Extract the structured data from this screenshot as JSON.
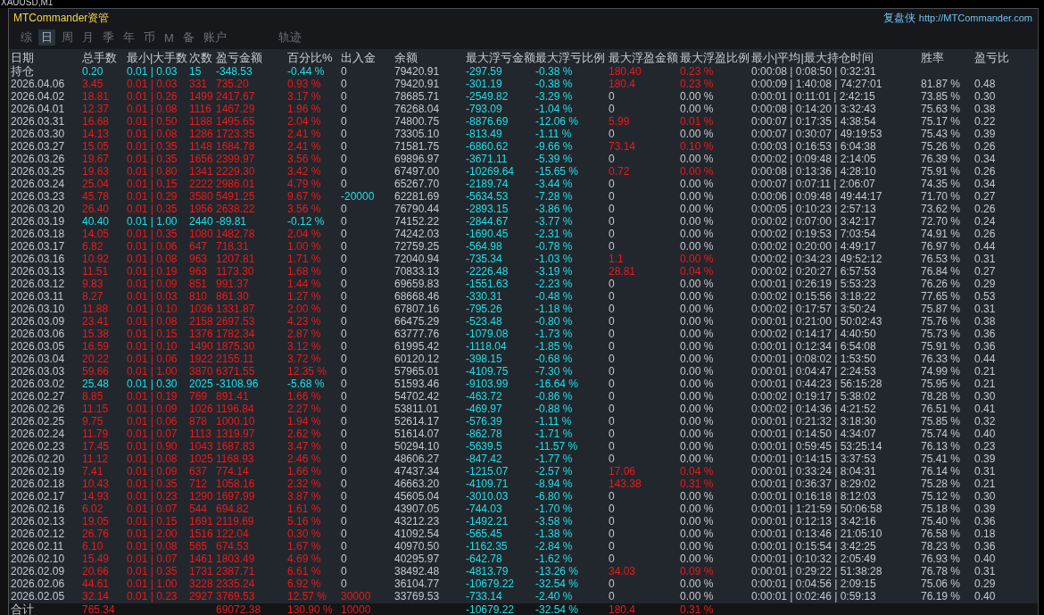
{
  "chart_window": {
    "symbol": "XAUUSD,M1"
  },
  "panel": {
    "title": "MTCommander资管",
    "brand": "复盘侠",
    "link": "http://MTCommander.com"
  },
  "tabs": [
    {
      "label": "综",
      "selected": false
    },
    {
      "label": "日",
      "selected": true
    },
    {
      "label": "周",
      "selected": false
    },
    {
      "label": "月",
      "selected": false
    },
    {
      "label": "季",
      "selected": false
    },
    {
      "label": "年",
      "selected": false
    },
    {
      "label": "币",
      "selected": false
    },
    {
      "label": "M",
      "selected": false
    },
    {
      "label": "备",
      "selected": false
    },
    {
      "label": "账户",
      "selected": false
    },
    {
      "label": "轨迹",
      "selected": false
    }
  ],
  "table": {
    "columns": [
      "日期",
      "总手数",
      "最小|大手数",
      "次数",
      "盈亏金额",
      "百分比%",
      "出入金",
      "余额",
      "最大浮亏金额",
      "最大浮亏比例",
      "最大浮盈金额",
      "最大浮盈比例",
      "最小|平均|最大持仓时间",
      "胜率",
      "盈亏比"
    ],
    "rows": [
      {
        "kind": "holding",
        "date": "持仓",
        "lots": "0.20",
        "lot_range": "0.01 | 0.03",
        "trades": "15",
        "pnl": "-348.53",
        "pnl_pct": "-0.44 %",
        "flow": "0",
        "balance": "79420.91",
        "max_float_loss": "-297.59",
        "max_float_loss_pct": "-0.38 %",
        "max_float_profit": "180.40",
        "max_float_profit_pct": "0.23 %",
        "hold_times": "0:00:08 | 0:08:50 | 0:32:31",
        "profitable": false,
        "float_profit_hit": true,
        "deposit": false,
        "withdrawal": false
      },
      {
        "kind": "day",
        "date": "2026.04.06",
        "lots": "3.45",
        "lot_range": "0.01 | 0.03",
        "trades": "331",
        "pnl": "735.20",
        "pnl_pct": "0.93 %",
        "flow": "0",
        "balance": "79420.91",
        "max_float_loss": "-301.19",
        "max_float_loss_pct": "-0.38 %",
        "max_float_profit": "180.4",
        "max_float_profit_pct": "0.23 %",
        "hold_times": "0:00:09 | 1:40:08 | 74:27:01",
        "win_rate": "81.87 %",
        "pl_ratio": "0.48",
        "profitable": true,
        "float_profit_hit": true,
        "deposit": false,
        "withdrawal": false
      },
      {
        "kind": "day",
        "date": "2026.04.02",
        "lots": "18.81",
        "lot_range": "0.01 | 0.26",
        "trades": "1499",
        "pnl": "2417.67",
        "pnl_pct": "3.17 %",
        "flow": "0",
        "balance": "78685.71",
        "max_float_loss": "-2549.82",
        "max_float_loss_pct": "-3.29 %",
        "max_float_profit": "0",
        "max_float_profit_pct": "0.00 %",
        "hold_times": "0:00:01 | 0:11:01 | 2:42:15",
        "win_rate": "73.85 %",
        "pl_ratio": "0.30",
        "profitable": true,
        "float_profit_hit": false,
        "deposit": false,
        "withdrawal": false
      },
      {
        "kind": "day",
        "date": "2026.04.01",
        "lots": "12.37",
        "lot_range": "0.01 | 0.08",
        "trades": "1116",
        "pnl": "1467.29",
        "pnl_pct": "1.96 %",
        "flow": "0",
        "balance": "76268.04",
        "max_float_loss": "-793.09",
        "max_float_loss_pct": "-1.04 %",
        "max_float_profit": "0",
        "max_float_profit_pct": "0.00 %",
        "hold_times": "0:00:08 | 0:14:20 | 3:32:43",
        "win_rate": "75.63 %",
        "pl_ratio": "0.38",
        "profitable": true,
        "float_profit_hit": false,
        "deposit": false,
        "withdrawal": false
      },
      {
        "kind": "day",
        "date": "2026.03.31",
        "lots": "16.68",
        "lot_range": "0.01 | 0.50",
        "trades": "1188",
        "pnl": "1495.65",
        "pnl_pct": "2.04 %",
        "flow": "0",
        "balance": "74800.75",
        "max_float_loss": "-8876.69",
        "max_float_loss_pct": "-12.06 %",
        "max_float_profit": "5.99",
        "max_float_profit_pct": "0.01 %",
        "hold_times": "0:00:07 | 0:17:35 | 4:38:54",
        "win_rate": "75.17 %",
        "pl_ratio": "0.22",
        "profitable": true,
        "float_profit_hit": true,
        "deposit": false,
        "withdrawal": false
      },
      {
        "kind": "day",
        "date": "2026.03.30",
        "lots": "14.13",
        "lot_range": "0.01 | 0.08",
        "trades": "1286",
        "pnl": "1723.35",
        "pnl_pct": "2.41 %",
        "flow": "0",
        "balance": "73305.10",
        "max_float_loss": "-813.49",
        "max_float_loss_pct": "-1.11 %",
        "max_float_profit": "0",
        "max_float_profit_pct": "0.00 %",
        "hold_times": "0:00:07 | 0:30:07 | 49:19:53",
        "win_rate": "75.43 %",
        "pl_ratio": "0.39",
        "profitable": true,
        "float_profit_hit": false,
        "deposit": false,
        "withdrawal": false
      },
      {
        "kind": "day",
        "date": "2026.03.27",
        "lots": "15.05",
        "lot_range": "0.01 | 0.35",
        "trades": "1148",
        "pnl": "1684.78",
        "pnl_pct": "2.41 %",
        "flow": "0",
        "balance": "71581.75",
        "max_float_loss": "-6860.62",
        "max_float_loss_pct": "-9.66 %",
        "max_float_profit": "73.14",
        "max_float_profit_pct": "0.10 %",
        "hold_times": "0:00:03 | 0:16:53 | 6:04:38",
        "win_rate": "75.26 %",
        "pl_ratio": "0.26",
        "profitable": true,
        "float_profit_hit": true,
        "deposit": false,
        "withdrawal": false
      },
      {
        "kind": "day",
        "date": "2026.03.26",
        "lots": "19.67",
        "lot_range": "0.01 | 0.35",
        "trades": "1656",
        "pnl": "2399.97",
        "pnl_pct": "3.56 %",
        "flow": "0",
        "balance": "69896.97",
        "max_float_loss": "-3671.11",
        "max_float_loss_pct": "-5.39 %",
        "max_float_profit": "0",
        "max_float_profit_pct": "0.00 %",
        "hold_times": "0:00:02 | 0:09:48 | 2:14:05",
        "win_rate": "76.39 %",
        "pl_ratio": "0.34",
        "profitable": true,
        "float_profit_hit": false,
        "deposit": false,
        "withdrawal": false
      },
      {
        "kind": "day",
        "date": "2026.03.25",
        "lots": "19.63",
        "lot_range": "0.01 | 0.80",
        "trades": "1341",
        "pnl": "2229.30",
        "pnl_pct": "3.42 %",
        "flow": "0",
        "balance": "67497.00",
        "max_float_loss": "-10269.64",
        "max_float_loss_pct": "-15.65 %",
        "max_float_profit": "0.72",
        "max_float_profit_pct": "0.00 %",
        "hold_times": "0:00:08 | 0:13:36 | 4:28:10",
        "win_rate": "75.91 %",
        "pl_ratio": "0.26",
        "profitable": true,
        "float_profit_hit": true,
        "deposit": false,
        "withdrawal": false
      },
      {
        "kind": "day",
        "date": "2026.03.24",
        "lots": "25.04",
        "lot_range": "0.01 | 0.15",
        "trades": "2222",
        "pnl": "2986.01",
        "pnl_pct": "4.79 %",
        "flow": "0",
        "balance": "65267.70",
        "max_float_loss": "-2189.74",
        "max_float_loss_pct": "-3.44 %",
        "max_float_profit": "0",
        "max_float_profit_pct": "0.00 %",
        "hold_times": "0:00:07 | 0:07:11 | 2:06:07",
        "win_rate": "74.35 %",
        "pl_ratio": "0.34",
        "profitable": true,
        "float_profit_hit": false,
        "deposit": false,
        "withdrawal": false
      },
      {
        "kind": "day",
        "date": "2026.03.23",
        "lots": "45.78",
        "lot_range": "0.01 | 0.29",
        "trades": "3580",
        "pnl": "5491.25",
        "pnl_pct": "9.67 %",
        "flow": "-20000",
        "balance": "62281.69",
        "max_float_loss": "-5634.53",
        "max_float_loss_pct": "-7.28 %",
        "max_float_profit": "0",
        "max_float_profit_pct": "0.00 %",
        "hold_times": "0:00:06 | 0:09:48 | 49:44:17",
        "win_rate": "71.70 %",
        "pl_ratio": "0.27",
        "profitable": true,
        "float_profit_hit": false,
        "deposit": false,
        "withdrawal": true
      },
      {
        "kind": "day",
        "date": "2026.03.20",
        "lots": "26.40",
        "lot_range": "0.01 | 0.35",
        "trades": "1956",
        "pnl": "2638.22",
        "pnl_pct": "3.56 %",
        "flow": "0",
        "balance": "76790.44",
        "max_float_loss": "-2893.15",
        "max_float_loss_pct": "-3.86 %",
        "max_float_profit": "0",
        "max_float_profit_pct": "0.00 %",
        "hold_times": "0:00:05 | 0:10:23 | 2:57:13",
        "win_rate": "73.62 %",
        "pl_ratio": "0.26",
        "profitable": true,
        "float_profit_hit": false,
        "deposit": false,
        "withdrawal": false
      },
      {
        "kind": "day",
        "date": "2026.03.19",
        "lots": "40.40",
        "lot_range": "0.01 | 1.00",
        "trades": "2440",
        "pnl": "-89.81",
        "pnl_pct": "-0.12 %",
        "flow": "0",
        "balance": "74152.22",
        "max_float_loss": "-2844.67",
        "max_float_loss_pct": "-3.77 %",
        "max_float_profit": "0",
        "max_float_profit_pct": "0.00 %",
        "hold_times": "0:00:02 | 0:07:00 | 3:42:17",
        "win_rate": "72.70 %",
        "pl_ratio": "0.24",
        "profitable": false,
        "float_profit_hit": false,
        "deposit": false,
        "withdrawal": false
      },
      {
        "kind": "day",
        "date": "2026.03.18",
        "lots": "14.05",
        "lot_range": "0.01 | 0.35",
        "trades": "1080",
        "pnl": "1482.78",
        "pnl_pct": "2.04 %",
        "flow": "0",
        "balance": "74242.03",
        "max_float_loss": "-1690.45",
        "max_float_loss_pct": "-2.31 %",
        "max_float_profit": "0",
        "max_float_profit_pct": "0.00 %",
        "hold_times": "0:00:02 | 0:19:53 | 7:03:54",
        "win_rate": "74.91 %",
        "pl_ratio": "0.26",
        "profitable": true,
        "float_profit_hit": false,
        "deposit": false,
        "withdrawal": false
      },
      {
        "kind": "day",
        "date": "2026.03.17",
        "lots": "6.82",
        "lot_range": "0.01 | 0.06",
        "trades": "647",
        "pnl": "718.31",
        "pnl_pct": "1.00 %",
        "flow": "0",
        "balance": "72759.25",
        "max_float_loss": "-564.98",
        "max_float_loss_pct": "-0.78 %",
        "max_float_profit": "0",
        "max_float_profit_pct": "0.00 %",
        "hold_times": "0:00:02 | 0:20:00 | 4:49:17",
        "win_rate": "76.97 %",
        "pl_ratio": "0.44",
        "profitable": true,
        "float_profit_hit": false,
        "deposit": false,
        "withdrawal": false
      },
      {
        "kind": "day",
        "date": "2026.03.16",
        "lots": "10.92",
        "lot_range": "0.01 | 0.08",
        "trades": "963",
        "pnl": "1207.81",
        "pnl_pct": "1.71 %",
        "flow": "0",
        "balance": "72040.94",
        "max_float_loss": "-735.34",
        "max_float_loss_pct": "-1.03 %",
        "max_float_profit": "1.1",
        "max_float_profit_pct": "0.00 %",
        "hold_times": "0:00:02 | 0:34:23 | 49:52:12",
        "win_rate": "76.53 %",
        "pl_ratio": "0.31",
        "profitable": true,
        "float_profit_hit": true,
        "deposit": false,
        "withdrawal": false
      },
      {
        "kind": "day",
        "date": "2026.03.13",
        "lots": "11.51",
        "lot_range": "0.01 | 0.19",
        "trades": "963",
        "pnl": "1173.30",
        "pnl_pct": "1.68 %",
        "flow": "0",
        "balance": "70833.13",
        "max_float_loss": "-2226.48",
        "max_float_loss_pct": "-3.19 %",
        "max_float_profit": "28.81",
        "max_float_profit_pct": "0.04 %",
        "hold_times": "0:00:02 | 0:20:27 | 6:57:53",
        "win_rate": "76.84 %",
        "pl_ratio": "0.27",
        "profitable": true,
        "float_profit_hit": true,
        "deposit": false,
        "withdrawal": false
      },
      {
        "kind": "day",
        "date": "2026.03.12",
        "lots": "9.83",
        "lot_range": "0.01 | 0.09",
        "trades": "851",
        "pnl": "991.37",
        "pnl_pct": "1.44 %",
        "flow": "0",
        "balance": "69659.83",
        "max_float_loss": "-1551.63",
        "max_float_loss_pct": "-2.23 %",
        "max_float_profit": "0",
        "max_float_profit_pct": "0.00 %",
        "hold_times": "0:00:01 | 0:26:19 | 5:53:23",
        "win_rate": "76.26 %",
        "pl_ratio": "0.29",
        "profitable": true,
        "float_profit_hit": false,
        "deposit": false,
        "withdrawal": false
      },
      {
        "kind": "day",
        "date": "2026.03.11",
        "lots": "8.27",
        "lot_range": "0.01 | 0.03",
        "trades": "810",
        "pnl": "861.30",
        "pnl_pct": "1.27 %",
        "flow": "0",
        "balance": "68668.46",
        "max_float_loss": "-330.31",
        "max_float_loss_pct": "-0.48 %",
        "max_float_profit": "0",
        "max_float_profit_pct": "0.00 %",
        "hold_times": "0:00:02 | 0:15:56 | 3:18:22",
        "win_rate": "77.65 %",
        "pl_ratio": "0.53",
        "profitable": true,
        "float_profit_hit": false,
        "deposit": false,
        "withdrawal": false
      },
      {
        "kind": "day",
        "date": "2026.03.10",
        "lots": "11.88",
        "lot_range": "0.01 | 0.10",
        "trades": "1036",
        "pnl": "1331.87",
        "pnl_pct": "2.00 %",
        "flow": "0",
        "balance": "67807.16",
        "max_float_loss": "-795.26",
        "max_float_loss_pct": "-1.18 %",
        "max_float_profit": "0",
        "max_float_profit_pct": "0.00 %",
        "hold_times": "0:00:02 | 0:17:57 | 3:50:24",
        "win_rate": "75.87 %",
        "pl_ratio": "0.31",
        "profitable": true,
        "float_profit_hit": false,
        "deposit": false,
        "withdrawal": false
      },
      {
        "kind": "day",
        "date": "2026.03.09",
        "lots": "23.41",
        "lot_range": "0.01 | 0.08",
        "trades": "2158",
        "pnl": "2697.53",
        "pnl_pct": "4.23 %",
        "flow": "0",
        "balance": "66475.29",
        "max_float_loss": "-523.48",
        "max_float_loss_pct": "-0.80 %",
        "max_float_profit": "0",
        "max_float_profit_pct": "0.00 %",
        "hold_times": "0:00:01 | 0:21:00 | 50:02:43",
        "win_rate": "75.76 %",
        "pl_ratio": "0.38",
        "profitable": true,
        "float_profit_hit": false,
        "deposit": false,
        "withdrawal": false
      },
      {
        "kind": "day",
        "date": "2026.03.06",
        "lots": "15.38",
        "lot_range": "0.01 | 0.15",
        "trades": "1376",
        "pnl": "1782.34",
        "pnl_pct": "2.87 %",
        "flow": "0",
        "balance": "63777.76",
        "max_float_loss": "-1079.08",
        "max_float_loss_pct": "-1.73 %",
        "max_float_profit": "0",
        "max_float_profit_pct": "0.00 %",
        "hold_times": "0:00:02 | 0:14:17 | 4:40:50",
        "win_rate": "75.73 %",
        "pl_ratio": "0.36",
        "profitable": true,
        "float_profit_hit": false,
        "deposit": false,
        "withdrawal": false
      },
      {
        "kind": "day",
        "date": "2026.03.05",
        "lots": "16.59",
        "lot_range": "0.01 | 0.10",
        "trades": "1490",
        "pnl": "1875.30",
        "pnl_pct": "3.12 %",
        "flow": "0",
        "balance": "61995.42",
        "max_float_loss": "-1118.04",
        "max_float_loss_pct": "-1.85 %",
        "max_float_profit": "0",
        "max_float_profit_pct": "0.00 %",
        "hold_times": "0:00:01 | 0:12:34 | 6:54:08",
        "win_rate": "75.91 %",
        "pl_ratio": "0.36",
        "profitable": true,
        "float_profit_hit": false,
        "deposit": false,
        "withdrawal": false
      },
      {
        "kind": "day",
        "date": "2026.03.04",
        "lots": "20.22",
        "lot_range": "0.01 | 0.06",
        "trades": "1922",
        "pnl": "2155.11",
        "pnl_pct": "3.72 %",
        "flow": "0",
        "balance": "60120.12",
        "max_float_loss": "-398.15",
        "max_float_loss_pct": "-0.68 %",
        "max_float_profit": "0",
        "max_float_profit_pct": "0.00 %",
        "hold_times": "0:00:01 | 0:08:02 | 1:53:50",
        "win_rate": "76.33 %",
        "pl_ratio": "0.44",
        "profitable": true,
        "float_profit_hit": false,
        "deposit": false,
        "withdrawal": false
      },
      {
        "kind": "day",
        "date": "2026.03.03",
        "lots": "59.66",
        "lot_range": "0.01 | 1.00",
        "trades": "3870",
        "pnl": "6371.55",
        "pnl_pct": "12.35 %",
        "flow": "0",
        "balance": "57965.01",
        "max_float_loss": "-4109.75",
        "max_float_loss_pct": "-7.30 %",
        "max_float_profit": "0",
        "max_float_profit_pct": "0.00 %",
        "hold_times": "0:00:01 | 0:04:47 | 2:24:53",
        "win_rate": "74.99 %",
        "pl_ratio": "0.21",
        "profitable": true,
        "float_profit_hit": false,
        "deposit": false,
        "withdrawal": false
      },
      {
        "kind": "day",
        "date": "2026.03.02",
        "lots": "25.48",
        "lot_range": "0.01 | 0.30",
        "trades": "2025",
        "pnl": "-3108.96",
        "pnl_pct": "-5.68 %",
        "flow": "0",
        "balance": "51593.46",
        "max_float_loss": "-9103.99",
        "max_float_loss_pct": "-16.64 %",
        "max_float_profit": "0",
        "max_float_profit_pct": "0.00 %",
        "hold_times": "0:00:01 | 0:44:23 | 56:15:28",
        "win_rate": "75.95 %",
        "pl_ratio": "0.21",
        "profitable": false,
        "float_profit_hit": false,
        "deposit": false,
        "withdrawal": false
      },
      {
        "kind": "day",
        "date": "2026.02.27",
        "lots": "8.85",
        "lot_range": "0.01 | 0.19",
        "trades": "769",
        "pnl": "891.41",
        "pnl_pct": "1.66 %",
        "flow": "0",
        "balance": "54702.42",
        "max_float_loss": "-463.72",
        "max_float_loss_pct": "-0.86 %",
        "max_float_profit": "0",
        "max_float_profit_pct": "0.00 %",
        "hold_times": "0:00:02 | 0:19:17 | 5:38:02",
        "win_rate": "78.28 %",
        "pl_ratio": "0.30",
        "profitable": true,
        "float_profit_hit": false,
        "deposit": false,
        "withdrawal": false
      },
      {
        "kind": "day",
        "date": "2026.02.26",
        "lots": "11.15",
        "lot_range": "0.01 | 0.09",
        "trades": "1026",
        "pnl": "1196.84",
        "pnl_pct": "2.27 %",
        "flow": "0",
        "balance": "53811.01",
        "max_float_loss": "-469.97",
        "max_float_loss_pct": "-0.88 %",
        "max_float_profit": "0",
        "max_float_profit_pct": "0.00 %",
        "hold_times": "0:00:02 | 0:14:36 | 4:21:52",
        "win_rate": "76.51 %",
        "pl_ratio": "0.41",
        "profitable": true,
        "float_profit_hit": false,
        "deposit": false,
        "withdrawal": false
      },
      {
        "kind": "day",
        "date": "2026.02.25",
        "lots": "9.75",
        "lot_range": "0.01 | 0.06",
        "trades": "878",
        "pnl": "1000.10",
        "pnl_pct": "1.94 %",
        "flow": "0",
        "balance": "52614.17",
        "max_float_loss": "-576.39",
        "max_float_loss_pct": "-1.11 %",
        "max_float_profit": "0",
        "max_float_profit_pct": "0.00 %",
        "hold_times": "0:00:01 | 0:21:32 | 3:18:30",
        "win_rate": "75.85 %",
        "pl_ratio": "0.32",
        "profitable": true,
        "float_profit_hit": false,
        "deposit": false,
        "withdrawal": false
      },
      {
        "kind": "day",
        "date": "2026.02.24",
        "lots": "11.79",
        "lot_range": "0.01 | 0.07",
        "trades": "1113",
        "pnl": "1319.97",
        "pnl_pct": "2.62 %",
        "flow": "0",
        "balance": "51614.07",
        "max_float_loss": "-862.78",
        "max_float_loss_pct": "-1.71 %",
        "max_float_profit": "0",
        "max_float_profit_pct": "0.00 %",
        "hold_times": "0:00:01 | 0:14:50 | 4:34:07",
        "win_rate": "75.74 %",
        "pl_ratio": "0.40",
        "profitable": true,
        "float_profit_hit": false,
        "deposit": false,
        "withdrawal": false
      },
      {
        "kind": "day",
        "date": "2026.02.23",
        "lots": "17.45",
        "lot_range": "0.01 | 0.90",
        "trades": "1043",
        "pnl": "1687.83",
        "pnl_pct": "3.47 %",
        "flow": "0",
        "balance": "50294.10",
        "max_float_loss": "-5639.5",
        "max_float_loss_pct": "-11.57 %",
        "max_float_profit": "0",
        "max_float_profit_pct": "0.00 %",
        "hold_times": "0:00:01 | 0:59:45 | 53:25:14",
        "win_rate": "76.13 %",
        "pl_ratio": "0.23",
        "profitable": true,
        "float_profit_hit": false,
        "deposit": false,
        "withdrawal": false
      },
      {
        "kind": "day",
        "date": "2026.02.20",
        "lots": "11.12",
        "lot_range": "0.01 | 0.08",
        "trades": "1025",
        "pnl": "1168.93",
        "pnl_pct": "2.46 %",
        "flow": "0",
        "balance": "48606.27",
        "max_float_loss": "-847.42",
        "max_float_loss_pct": "-1.77 %",
        "max_float_profit": "0",
        "max_float_profit_pct": "0.00 %",
        "hold_times": "0:00:01 | 0:14:15 | 3:37:53",
        "win_rate": "75.41 %",
        "pl_ratio": "0.39",
        "profitable": true,
        "float_profit_hit": false,
        "deposit": false,
        "withdrawal": false
      },
      {
        "kind": "day",
        "date": "2026.02.19",
        "lots": "7.41",
        "lot_range": "0.01 | 0.09",
        "trades": "637",
        "pnl": "774.14",
        "pnl_pct": "1.66 %",
        "flow": "0",
        "balance": "47437.34",
        "max_float_loss": "-1215.07",
        "max_float_loss_pct": "-2.57 %",
        "max_float_profit": "17.06",
        "max_float_profit_pct": "0.04 %",
        "hold_times": "0:00:01 | 0:33:24 | 8:04:31",
        "win_rate": "76.14 %",
        "pl_ratio": "0.31",
        "profitable": true,
        "float_profit_hit": true,
        "deposit": false,
        "withdrawal": false
      },
      {
        "kind": "day",
        "date": "2026.02.18",
        "lots": "10.43",
        "lot_range": "0.01 | 0.35",
        "trades": "712",
        "pnl": "1058.16",
        "pnl_pct": "2.32 %",
        "flow": "0",
        "balance": "46663.20",
        "max_float_loss": "-4109.71",
        "max_float_loss_pct": "-8.94 %",
        "max_float_profit": "143.38",
        "max_float_profit_pct": "0.31 %",
        "hold_times": "0:00:01 | 0:36:37 | 8:29:02",
        "win_rate": "75.28 %",
        "pl_ratio": "0.21",
        "profitable": true,
        "float_profit_hit": true,
        "deposit": false,
        "withdrawal": false
      },
      {
        "kind": "day",
        "date": "2026.02.17",
        "lots": "14.93",
        "lot_range": "0.01 | 0.23",
        "trades": "1290",
        "pnl": "1697.99",
        "pnl_pct": "3.87 %",
        "flow": "0",
        "balance": "45605.04",
        "max_float_loss": "-3010.03",
        "max_float_loss_pct": "-6.80 %",
        "max_float_profit": "0",
        "max_float_profit_pct": "0.00 %",
        "hold_times": "0:00:01 | 0:16:18 | 8:12:03",
        "win_rate": "75.12 %",
        "pl_ratio": "0.30",
        "profitable": true,
        "float_profit_hit": false,
        "deposit": false,
        "withdrawal": false
      },
      {
        "kind": "day",
        "date": "2026.02.16",
        "lots": "6.02",
        "lot_range": "0.01 | 0.07",
        "trades": "544",
        "pnl": "694.82",
        "pnl_pct": "1.61 %",
        "flow": "0",
        "balance": "43907.05",
        "max_float_loss": "-744.03",
        "max_float_loss_pct": "-1.70 %",
        "max_float_profit": "0",
        "max_float_profit_pct": "0.00 %",
        "hold_times": "0:00:01 | 1:21:59 | 50:06:58",
        "win_rate": "75.18 %",
        "pl_ratio": "0.39",
        "profitable": true,
        "float_profit_hit": false,
        "deposit": false,
        "withdrawal": false
      },
      {
        "kind": "day",
        "date": "2026.02.13",
        "lots": "19.05",
        "lot_range": "0.01 | 0.15",
        "trades": "1691",
        "pnl": "2119.69",
        "pnl_pct": "5.16 %",
        "flow": "0",
        "balance": "43212.23",
        "max_float_loss": "-1492.21",
        "max_float_loss_pct": "-3.58 %",
        "max_float_profit": "0",
        "max_float_profit_pct": "0.00 %",
        "hold_times": "0:00:01 | 0:12:13 | 3:42:16",
        "win_rate": "75.40 %",
        "pl_ratio": "0.36",
        "profitable": true,
        "float_profit_hit": false,
        "deposit": false,
        "withdrawal": false
      },
      {
        "kind": "day",
        "date": "2026.02.12",
        "lots": "26.76",
        "lot_range": "0.01 | 2.00",
        "trades": "1516",
        "pnl": "122.04",
        "pnl_pct": "0.30 %",
        "flow": "0",
        "balance": "41092.54",
        "max_float_loss": "-565.45",
        "max_float_loss_pct": "-1.38 %",
        "max_float_profit": "0",
        "max_float_profit_pct": "0.00 %",
        "hold_times": "0:00:01 | 0:13:46 | 21:05:10",
        "win_rate": "76.58 %",
        "pl_ratio": "0.18",
        "profitable": true,
        "float_profit_hit": false,
        "deposit": false,
        "withdrawal": false
      },
      {
        "kind": "day",
        "date": "2026.02.11",
        "lots": "6.10",
        "lot_range": "0.01 | 0.08",
        "trades": "565",
        "pnl": "674.53",
        "pnl_pct": "1.67 %",
        "flow": "0",
        "balance": "40970.50",
        "max_float_loss": "-1162.35",
        "max_float_loss_pct": "-2.84 %",
        "max_float_profit": "0",
        "max_float_profit_pct": "0.00 %",
        "hold_times": "0:00:01 | 0:15:54 | 3:42:25",
        "win_rate": "78.23 %",
        "pl_ratio": "0.36",
        "profitable": true,
        "float_profit_hit": false,
        "deposit": false,
        "withdrawal": false
      },
      {
        "kind": "day",
        "date": "2026.02.10",
        "lots": "15.49",
        "lot_range": "0.01 | 0.07",
        "trades": "1461",
        "pnl": "1803.49",
        "pnl_pct": "4.69 %",
        "flow": "0",
        "balance": "40295.97",
        "max_float_loss": "-642.78",
        "max_float_loss_pct": "-1.62 %",
        "max_float_profit": "0",
        "max_float_profit_pct": "0.00 %",
        "hold_times": "0:00:01 | 0:10:32 | 2:05:49",
        "win_rate": "76.93 %",
        "pl_ratio": "0.40",
        "profitable": true,
        "float_profit_hit": false,
        "deposit": false,
        "withdrawal": false
      },
      {
        "kind": "day",
        "date": "2026.02.09",
        "lots": "20.66",
        "lot_range": "0.01 | 0.35",
        "trades": "1731",
        "pnl": "2387.71",
        "pnl_pct": "6.61 %",
        "flow": "0",
        "balance": "38492.48",
        "max_float_loss": "-4813.79",
        "max_float_loss_pct": "-13.26 %",
        "max_float_profit": "34.03",
        "max_float_profit_pct": "0.09 %",
        "hold_times": "0:00:01 | 0:29:22 | 51:38:28",
        "win_rate": "76.78 %",
        "pl_ratio": "0.31",
        "profitable": true,
        "float_profit_hit": true,
        "deposit": false,
        "withdrawal": false
      },
      {
        "kind": "day",
        "date": "2026.02.06",
        "lots": "44.61",
        "lot_range": "0.01 | 1.00",
        "trades": "3228",
        "pnl": "2335.24",
        "pnl_pct": "6.92 %",
        "flow": "0",
        "balance": "36104.77",
        "max_float_loss": "-10679.22",
        "max_float_loss_pct": "-32.54 %",
        "max_float_profit": "0",
        "max_float_profit_pct": "0.00 %",
        "hold_times": "0:00:01 | 0:04:56 | 2:09:15",
        "win_rate": "75.06 %",
        "pl_ratio": "0.29",
        "profitable": true,
        "float_profit_hit": false,
        "deposit": false,
        "withdrawal": false
      },
      {
        "kind": "day",
        "date": "2026.02.05",
        "lots": "32.14",
        "lot_range": "0.01 | 0.23",
        "trades": "2927",
        "pnl": "3769.53",
        "pnl_pct": "12.57 %",
        "flow": "30000",
        "balance": "33769.53",
        "max_float_loss": "-733.14",
        "max_float_loss_pct": "-2.40 %",
        "max_float_profit": "0",
        "max_float_profit_pct": "0.00 %",
        "hold_times": "0:00:01 | 0:02:46 | 0:59:13",
        "win_rate": "76.19 %",
        "pl_ratio": "0.40",
        "profitable": true,
        "float_profit_hit": false,
        "deposit": true,
        "withdrawal": false
      },
      {
        "kind": "total",
        "date": "合计",
        "lots": "765.34",
        "pnl": "69072.38",
        "pnl_pct": "130.90 %",
        "flow": "10000",
        "max_float_loss": "-10679.22",
        "max_float_loss_pct": "-32.54 %",
        "max_float_profit": "180.4",
        "max_float_profit_pct": "0.31 %",
        "profitable": true,
        "float_profit_hit": true,
        "deposit": true,
        "withdrawal": false
      }
    ]
  }
}
